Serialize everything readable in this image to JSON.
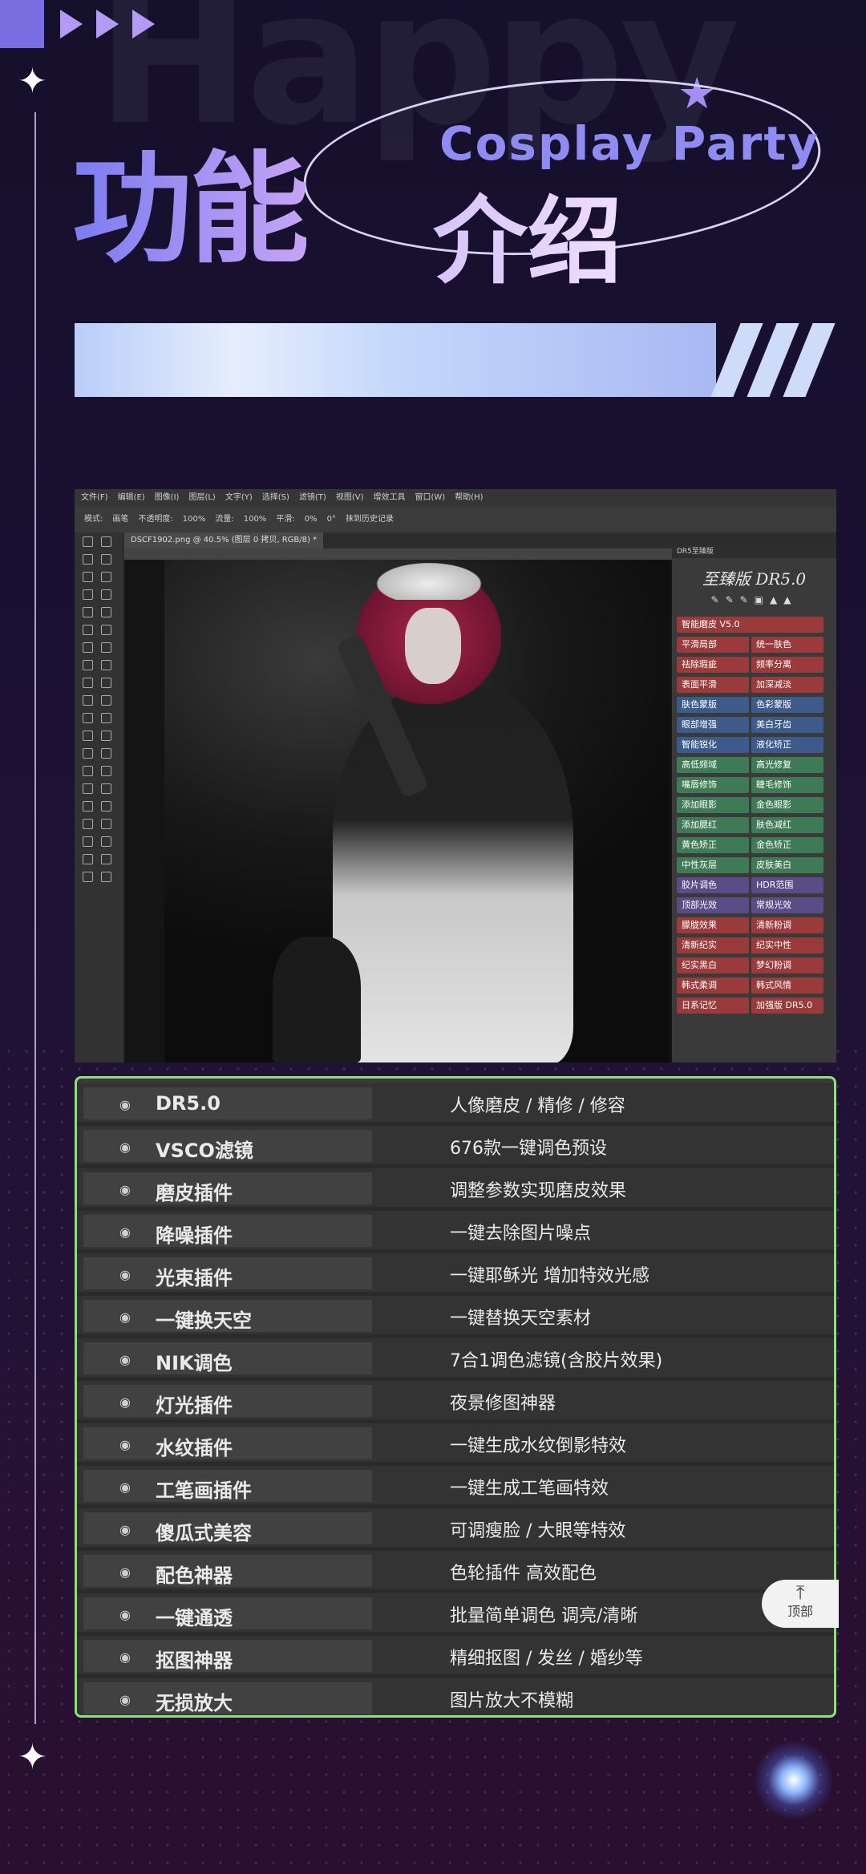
{
  "decor": {
    "bg_word": "Happy"
  },
  "header": {
    "title_main": "功能",
    "title_sub": "介绍",
    "tagline": "Cosplay Party"
  },
  "ps": {
    "menu": [
      "文件(F)",
      "编辑(E)",
      "图像(I)",
      "图层(L)",
      "文字(Y)",
      "选择(S)",
      "滤镜(T)",
      "视图(V)",
      "增效工具",
      "窗口(W)",
      "帮助(H)"
    ],
    "options": [
      "模式:",
      "画笔",
      "不透明度:",
      "100%",
      "流量:",
      "100%",
      "平滑:",
      "0%",
      "0°",
      "抹到历史记录"
    ],
    "doc_tab": "DSCF1902.png @ 40.5% (图层 0 拷贝, RGB/8) *",
    "panel_tab": "DR5至臻版",
    "panel_title": "至臻版 DR5.0",
    "panel_buttons": [
      {
        "label": "智能磨皮 V5.0",
        "color": "red",
        "wide": true
      },
      {
        "label": "平滑局部",
        "color": "red"
      },
      {
        "label": "统一肤色",
        "color": "red"
      },
      {
        "label": "祛除瑕疵",
        "color": "red"
      },
      {
        "label": "频率分离",
        "color": "red"
      },
      {
        "label": "表面平滑",
        "color": "red"
      },
      {
        "label": "加深减淡",
        "color": "red"
      },
      {
        "label": "肤色蒙版",
        "color": "blue"
      },
      {
        "label": "色彩蒙版",
        "color": "blue"
      },
      {
        "label": "眼部增强",
        "color": "blue"
      },
      {
        "label": "美白牙齿",
        "color": "blue"
      },
      {
        "label": "智能锐化",
        "color": "blue"
      },
      {
        "label": "液化矫正",
        "color": "blue"
      },
      {
        "label": "高低频域",
        "color": "green"
      },
      {
        "label": "高光修复",
        "color": "green"
      },
      {
        "label": "嘴唇修饰",
        "color": "green"
      },
      {
        "label": "睫毛修饰",
        "color": "green"
      },
      {
        "label": "添加眼影",
        "color": "green"
      },
      {
        "label": "金色眼影",
        "color": "green"
      },
      {
        "label": "添加腮红",
        "color": "green"
      },
      {
        "label": "肤色减红",
        "color": "green"
      },
      {
        "label": "黄色矫正",
        "color": "green"
      },
      {
        "label": "金色矫正",
        "color": "green"
      },
      {
        "label": "中性灰层",
        "color": "green"
      },
      {
        "label": "皮肤美白",
        "color": "green"
      },
      {
        "label": "胶片调色",
        "color": "purple"
      },
      {
        "label": "HDR范围",
        "color": "purple"
      },
      {
        "label": "顶部光效",
        "color": "purple"
      },
      {
        "label": "常规光效",
        "color": "purple"
      },
      {
        "label": "朦胧效果",
        "color": "red"
      },
      {
        "label": "清新粉调",
        "color": "red"
      },
      {
        "label": "清新纪实",
        "color": "red"
      },
      {
        "label": "纪实中性",
        "color": "red"
      },
      {
        "label": "纪实黑白",
        "color": "red"
      },
      {
        "label": "梦幻粉调",
        "color": "red"
      },
      {
        "label": "韩式柔调",
        "color": "red"
      },
      {
        "label": "韩式风情",
        "color": "red"
      },
      {
        "label": "日系记忆",
        "color": "red"
      },
      {
        "label": "加强版 DR5.0",
        "color": "red"
      }
    ]
  },
  "features": [
    {
      "name": "DR5.0",
      "desc": "人像磨皮 / 精修 / 修容"
    },
    {
      "name": "VSCO滤镜",
      "desc": "676款一键调色预设"
    },
    {
      "name": "磨皮插件",
      "desc": "调整参数实现磨皮效果"
    },
    {
      "name": "降噪插件",
      "desc": "一键去除图片噪点"
    },
    {
      "name": "光束插件",
      "desc": "一键耶稣光 增加特效光感"
    },
    {
      "name": "一键换天空",
      "desc": "一键替换天空素材"
    },
    {
      "name": "NIK调色",
      "desc": "7合1调色滤镜(含胶片效果)"
    },
    {
      "name": "灯光插件",
      "desc": "夜景修图神器"
    },
    {
      "name": "水纹插件",
      "desc": "一键生成水纹倒影特效"
    },
    {
      "name": "工笔画插件",
      "desc": "一键生成工笔画特效"
    },
    {
      "name": "傻瓜式美容",
      "desc": "可调瘦脸 / 大眼等特效"
    },
    {
      "name": "配色神器",
      "desc": "色轮插件 高效配色"
    },
    {
      "name": "一键通透",
      "desc": "批量简单调色 调亮/清晰"
    },
    {
      "name": "抠图神器",
      "desc": "精细抠图 / 发丝 / 婚纱等"
    },
    {
      "name": "无损放大",
      "desc": "图片放大不模糊"
    }
  ],
  "back_to_top": {
    "arrow": "⤒",
    "label": "顶部"
  },
  "colors": {
    "accent_border": "#8fe07a",
    "title_gradient_start": "#7b7cf0",
    "title_gradient_end": "#c6a4f5"
  }
}
